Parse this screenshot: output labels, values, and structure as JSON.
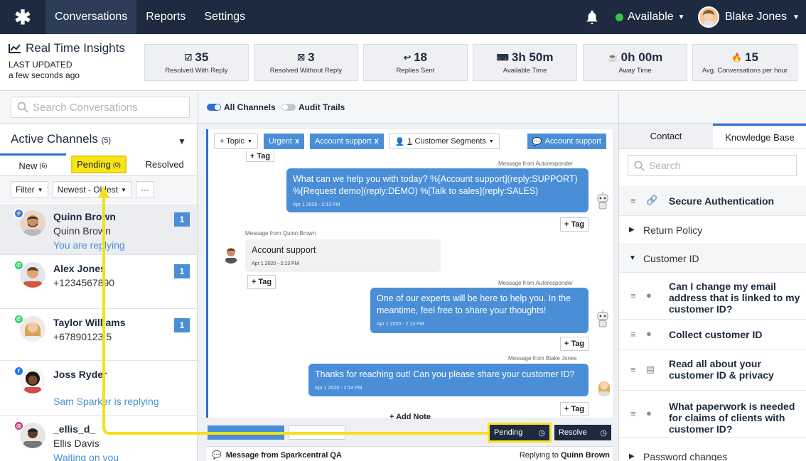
{
  "topbar": {
    "logo": "✱",
    "nav": [
      "Conversations",
      "Reports",
      "Settings"
    ],
    "status": "Available",
    "user": "Blake Jones"
  },
  "insights": {
    "title": "Real Time Insights",
    "last_updated_label": "LAST UPDATED",
    "last_updated_value": "a few seconds ago",
    "stats": [
      {
        "value": "35",
        "label": "Resolved With Reply",
        "icon": "check-square-icon"
      },
      {
        "value": "3",
        "label": "Resolved Without Reply",
        "icon": "check-box-icon"
      },
      {
        "value": "18",
        "label": "Replies Sent",
        "icon": "reply-all-icon"
      },
      {
        "value": "3h 50m",
        "label": "Available Time",
        "icon": "keyboard-icon"
      },
      {
        "value": "0h 00m",
        "label": "Away Time",
        "icon": "coffee-icon"
      },
      {
        "value": "15",
        "label": "Avg. Conversations per hour",
        "icon": "flame-icon"
      }
    ]
  },
  "search": {
    "placeholder": "Search Conversations",
    "toggle1": "All Channels",
    "toggle2": "Audit Trails"
  },
  "left": {
    "header": "Active Channels",
    "header_count": "(5)",
    "tabs": [
      {
        "label": "New",
        "count": "(6)"
      },
      {
        "label": "Pending",
        "count": "(0)"
      },
      {
        "label": "Resolved",
        "count": ""
      }
    ],
    "filter": "Filter",
    "sort": "Newest - Oldest",
    "more": "···",
    "conversations": [
      {
        "name": "Quinn Brown",
        "sub": "Quinn Brown",
        "status": "You are replying",
        "badge": "1",
        "channel": "messenger"
      },
      {
        "name": "Alex Jones",
        "sub": "+1234567890",
        "status": "",
        "badge": "1",
        "channel": "whatsapp"
      },
      {
        "name": "Taylor Williams",
        "sub": "+67890123.5",
        "status": "",
        "badge": "1",
        "channel": "whatsapp"
      },
      {
        "name": "Joss Ryder",
        "sub": "",
        "status": "Sam Sparker is replying",
        "badge": "",
        "channel": "facebook"
      },
      {
        "name": "_ellis_d_",
        "sub": "Ellis Davis",
        "status": "Waiting on you",
        "badge": "",
        "channel": "instagram"
      }
    ]
  },
  "center": {
    "toolbar": {
      "topic": "+ Topic",
      "tag1": "Urgent",
      "tag2": "Account support",
      "segments_count": "1",
      "segments": "Customer Segments",
      "team": "Account support"
    },
    "messages": [
      {
        "meta": "Message from Autoresponder",
        "text": "What can we help you with today? %[Account support](reply:SUPPORT) %[Request demo](reply:DEMO) %[Talk to sales](reply:SALES)",
        "time": "Apr 1 2020 - 2:13 PM"
      },
      {
        "meta": "Message from Quinn Brown",
        "text": "Account support",
        "time": "Apr 1 2020 - 2:13 PM"
      },
      {
        "meta": "Message from Autoresponder",
        "text": "One of our experts will be here to help you. In the meantime, feel free to share your thoughts!",
        "time": "Apr 1 2020 - 2:13 PM"
      },
      {
        "meta": "Message from Blake Jones",
        "text": "Thanks for reaching out! Can you please share your customer ID?",
        "time": "Apr 1 2020 - 2:14 PM"
      }
    ],
    "tag_label": "+ Tag",
    "tag_label_top": "+ Tag",
    "add_note": "+ Add Note",
    "pending": "Pending",
    "resolve": "Resolve",
    "footer_from": "Message from Sparkcentral QA",
    "footer_reply_prefix": "Replying to",
    "footer_reply_name": "Quinn Brown"
  },
  "right": {
    "tabs": [
      "Contact",
      "Knowledge Base"
    ],
    "search_placeholder": "Search",
    "items": [
      {
        "text": "Secure Authentication",
        "kind": "article-link"
      },
      {
        "text": "Return Policy",
        "kind": "section-collapsed"
      },
      {
        "text": "Customer ID",
        "kind": "section-expanded"
      },
      {
        "text": "Can I change my email address that is linked to my customer ID?",
        "kind": "reply"
      },
      {
        "text": "Collect customer ID",
        "kind": "reply"
      },
      {
        "text": "Read all about your customer ID & privacy",
        "kind": "article"
      },
      {
        "text": "What paperwork is needed for claims of clients with customer ID?",
        "kind": "reply"
      },
      {
        "text": "Password changes",
        "kind": "section-collapsed"
      }
    ]
  },
  "colors": {
    "accent": "#4a8ed8",
    "navy": "#1d2a3f",
    "highlight": "#f7e51b",
    "available": "#3bc44b"
  }
}
